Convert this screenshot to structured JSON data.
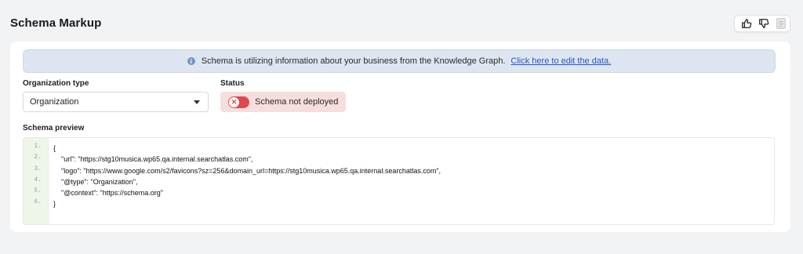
{
  "header": {
    "title": "Schema Markup"
  },
  "feedback": {
    "thumbs_up_icon": "thumbs-up-icon",
    "thumbs_down_icon": "thumbs-down-icon",
    "doc_icon": "document-icon"
  },
  "banner": {
    "icon": "info-icon",
    "text": "Schema is utilizing information about your business from the Knowledge Graph.",
    "link": "Click here to edit the data."
  },
  "org_type": {
    "label": "Organization type",
    "value": "Organization"
  },
  "status": {
    "label": "Status",
    "text": "Schema not deployed",
    "toggle_on": false
  },
  "preview": {
    "label": "Schema preview",
    "line_numbers": [
      "1.",
      "2.",
      "3.",
      "4.",
      "5.",
      "6."
    ],
    "lines": [
      "{",
      "\"url\": \"https://stg10musica.wp65.qa.internal.searchatlas.com\",",
      "\"logo\": \"https://www.google.com/s2/favicons?sz=256&domain_url=https://stg10musica.wp65.qa.internal.searchatlas.com\",",
      "\"@type\": \"Organization\",",
      "\"@context\": \"https://schema.org\"",
      "}"
    ]
  },
  "colors": {
    "banner_bg": "#dde5f1",
    "link": "#2a56c6",
    "status_bg": "#f7dede",
    "toggle": "#e0484f",
    "gutter_bg": "#eef6ea"
  }
}
